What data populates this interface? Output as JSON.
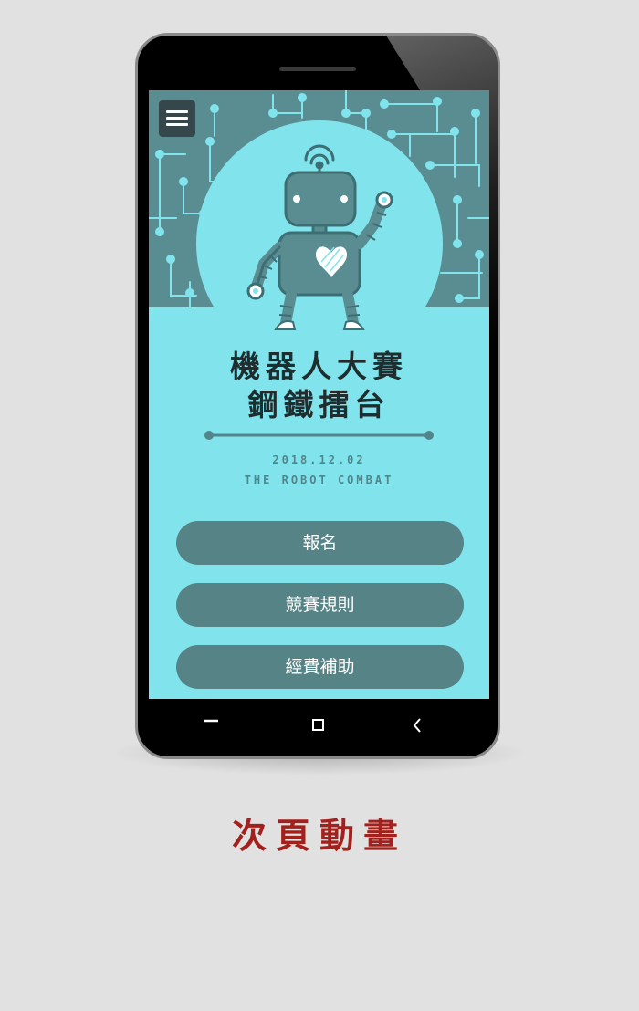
{
  "screen": {
    "menu_icon": "hamburger-menu-icon",
    "title_line1": "機器人大賽",
    "title_line2": "鋼鐵擂台",
    "date": "2018.12.02",
    "subtitle": "THE ROBOT COMBAT",
    "buttons": [
      {
        "label": "報名"
      },
      {
        "label": "競賽規則"
      },
      {
        "label": "經費補助"
      }
    ]
  },
  "navbar": {
    "icons": [
      "menu-icon",
      "home-square-icon",
      "back-chevron-icon"
    ]
  },
  "caption": "次頁動畫",
  "colors": {
    "background": "#e1e1e1",
    "screen": "#81e4ec",
    "circuit_board": "#5a8d92",
    "button": "#558386",
    "caption": "#a3211c"
  }
}
